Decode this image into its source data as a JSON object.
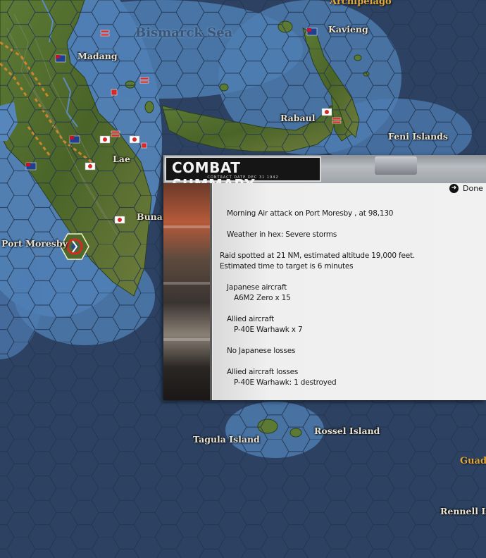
{
  "map": {
    "labels": {
      "sea": "Bismarck Sea",
      "archipelago": "Archipelago",
      "madang": "Madang",
      "kavieng": "Kavieng",
      "rabaul": "Rabaul",
      "feni": "Feni Islands",
      "lae": "Lae",
      "buna": "Buna",
      "port_moresby": "Port Moresby",
      "tagula": "Tagula Island",
      "rossel": "Rossel Island",
      "guad": "Guad",
      "rennell": "Rennell Isl"
    },
    "colors": {
      "ocean_deep": "#2d4262",
      "ocean_shallow": "#5b8bbf",
      "land": "#4f6a2c",
      "allied_flag": "#1f3f8f",
      "japan_flag": "#d62828"
    },
    "icons": [
      "allied-flag-icon",
      "japanese-flag-icon",
      "airbase-target-icon",
      "ship-icon"
    ]
  },
  "dialog": {
    "title": "COMBAT SUMMARY",
    "contract_date": "CONTRACT DATE DEC 31 1942",
    "done_label": "Done",
    "lines": [
      "Morning Air attack on Port Moresby , at 98,130",
      "Weather in hex: Severe storms",
      "Raid spotted at 21 NM, estimated altitude 19,000 feet.",
      "Estimated time to target is 6 minutes",
      "Japanese aircraft",
      "A6M2 Zero x 15",
      "Allied aircraft",
      "P-40E Warhawk x 7",
      "No Japanese losses",
      "Allied aircraft losses",
      "P-40E Warhawk: 1 destroyed"
    ]
  }
}
